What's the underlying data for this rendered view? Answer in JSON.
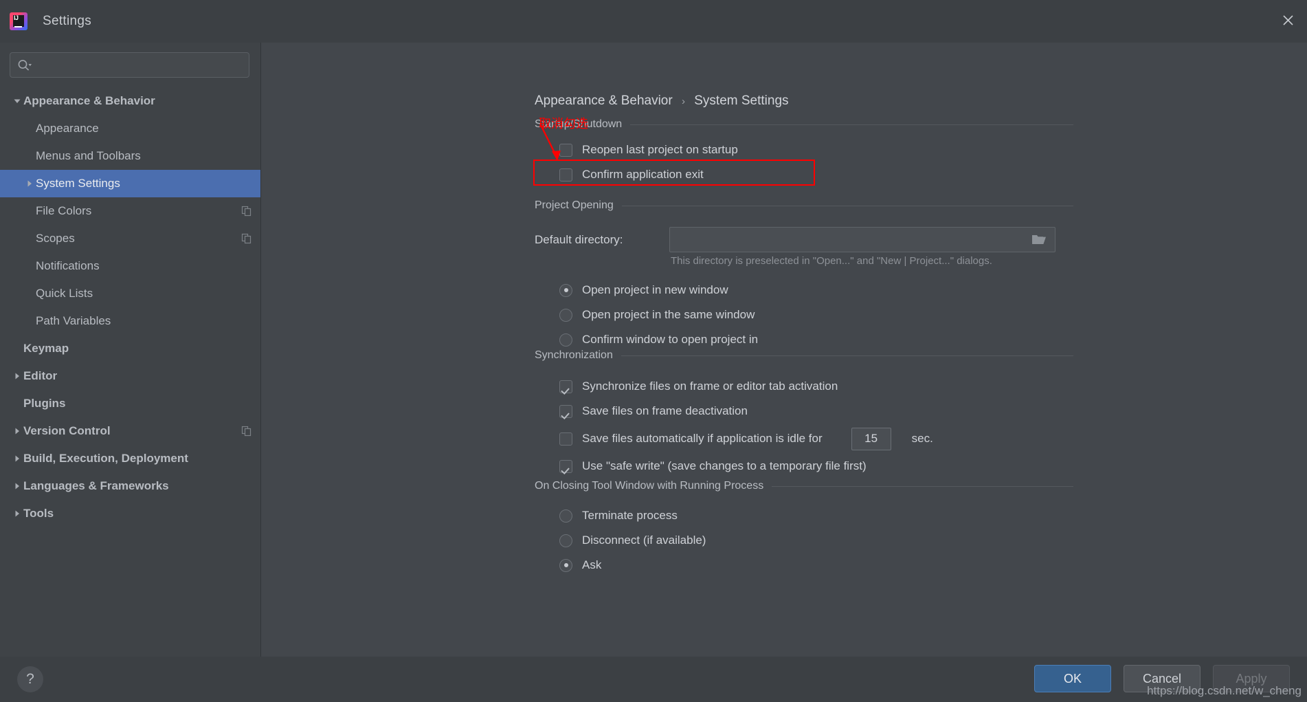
{
  "window": {
    "title": "Settings",
    "app_icon": "intellij-idea-icon",
    "close_icon": "close-icon"
  },
  "search": {
    "placeholder": "",
    "value": "",
    "icon": "search-icon"
  },
  "sidebar": {
    "items": [
      {
        "label": "Appearance & Behavior",
        "level": 0,
        "twisty": "expanded",
        "selected": false,
        "copy_icon": false
      },
      {
        "label": "Appearance",
        "level": 1,
        "twisty": "none",
        "selected": false,
        "copy_icon": false
      },
      {
        "label": "Menus and Toolbars",
        "level": 1,
        "twisty": "none",
        "selected": false,
        "copy_icon": false
      },
      {
        "label": "System Settings",
        "level": 1,
        "twisty": "collapsed",
        "selected": true,
        "copy_icon": false
      },
      {
        "label": "File Colors",
        "level": 1,
        "twisty": "none",
        "selected": false,
        "copy_icon": true
      },
      {
        "label": "Scopes",
        "level": 1,
        "twisty": "none",
        "selected": false,
        "copy_icon": true
      },
      {
        "label": "Notifications",
        "level": 1,
        "twisty": "none",
        "selected": false,
        "copy_icon": false
      },
      {
        "label": "Quick Lists",
        "level": 1,
        "twisty": "none",
        "selected": false,
        "copy_icon": false
      },
      {
        "label": "Path Variables",
        "level": 1,
        "twisty": "none",
        "selected": false,
        "copy_icon": false
      },
      {
        "label": "Keymap",
        "level": 0,
        "twisty": "none",
        "selected": false,
        "copy_icon": false
      },
      {
        "label": "Editor",
        "level": 0,
        "twisty": "collapsed",
        "selected": false,
        "copy_icon": false
      },
      {
        "label": "Plugins",
        "level": 0,
        "twisty": "none",
        "selected": false,
        "copy_icon": false
      },
      {
        "label": "Version Control",
        "level": 0,
        "twisty": "collapsed",
        "selected": false,
        "copy_icon": true
      },
      {
        "label": "Build, Execution, Deployment",
        "level": 0,
        "twisty": "collapsed",
        "selected": false,
        "copy_icon": false
      },
      {
        "label": "Languages & Frameworks",
        "level": 0,
        "twisty": "collapsed",
        "selected": false,
        "copy_icon": false
      },
      {
        "label": "Tools",
        "level": 0,
        "twisty": "collapsed",
        "selected": false,
        "copy_icon": false
      }
    ]
  },
  "breadcrumb": {
    "root": "Appearance & Behavior",
    "separator": "›",
    "current": "System Settings"
  },
  "annotation": {
    "text": "取消勾选",
    "color": "#ff0000"
  },
  "startup_shutdown": {
    "heading": "Startup/Shutdown",
    "items": [
      {
        "label": "Reopen last project on startup",
        "checked": false
      },
      {
        "label": "Confirm application exit",
        "checked": false
      }
    ]
  },
  "project_opening": {
    "heading": "Project Opening",
    "dir_label": "Default directory:",
    "dir_value": "",
    "dir_placeholder": "",
    "browse_icon": "folder-icon",
    "hint": "This directory is preselected in \"Open...\" and \"New | Project...\" dialogs.",
    "options": [
      {
        "label": "Open project in new window",
        "selected": true
      },
      {
        "label": "Open project in the same window",
        "selected": false
      },
      {
        "label": "Confirm window to open project in",
        "selected": false
      }
    ]
  },
  "synchronization": {
    "heading": "Synchronization",
    "items": [
      {
        "label": "Synchronize files on frame or editor tab activation",
        "checked": true
      },
      {
        "label": "Save files on frame deactivation",
        "checked": true
      },
      {
        "label": "Save files automatically if application is idle for",
        "checked": false
      },
      {
        "label": "Use \"safe write\" (save changes to a temporary file first)",
        "checked": true
      }
    ],
    "idle_seconds": "15",
    "idle_unit": "sec."
  },
  "closing_tool_window": {
    "heading": "On Closing Tool Window with Running Process",
    "options": [
      {
        "label": "Terminate process",
        "selected": false
      },
      {
        "label": "Disconnect (if available)",
        "selected": false
      },
      {
        "label": "Ask",
        "selected": true
      }
    ]
  },
  "footer": {
    "help_label": "?",
    "ok_label": "OK",
    "cancel_label": "Cancel",
    "apply_label": "Apply",
    "watermark": "https://blog.csdn.net/w_cheng"
  },
  "colors": {
    "accent": "#4b6eaf",
    "ok_button": "#36618f",
    "annotation": "#ff0000",
    "panel_bg": "#43474c",
    "sidebar_bg": "#3f4347",
    "titlebar_bg": "#3c4044"
  }
}
